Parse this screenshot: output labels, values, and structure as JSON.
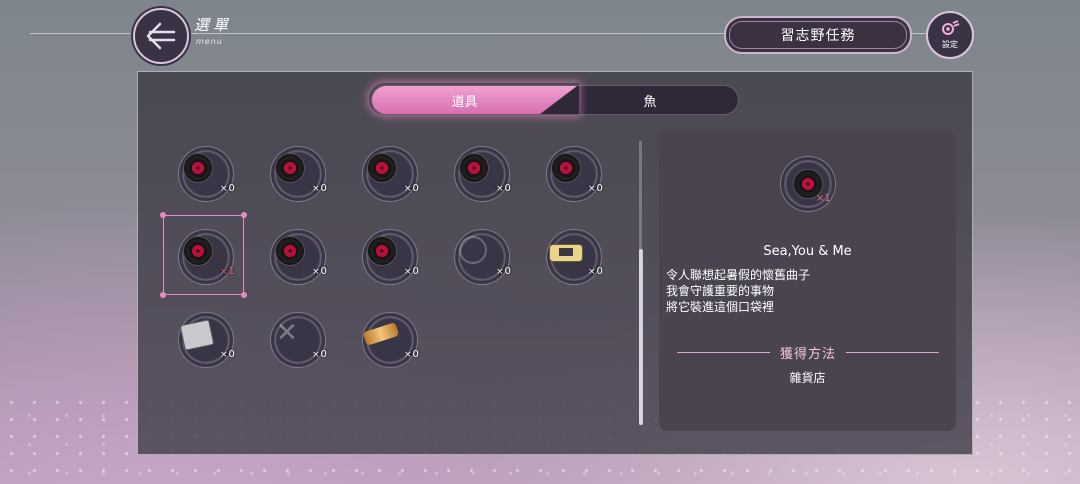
{
  "header": {
    "menu_title": "選單",
    "menu_subtitle": "menu",
    "mission_button": "習志野任務",
    "settings_label": "設定"
  },
  "tabs": [
    {
      "label": "道具",
      "active": true
    },
    {
      "label": "魚",
      "active": false
    }
  ],
  "items": [
    {
      "icon": "vinyl-record-icon",
      "count": "0"
    },
    {
      "icon": "vinyl-record-icon",
      "count": "0"
    },
    {
      "icon": "vinyl-record-icon",
      "count": "0"
    },
    {
      "icon": "vinyl-record-icon",
      "count": "0"
    },
    {
      "icon": "vinyl-record-icon",
      "count": "0"
    },
    {
      "icon": "vinyl-record-icon",
      "count": "1",
      "selected": true
    },
    {
      "icon": "vinyl-record-icon",
      "count": "0"
    },
    {
      "icon": "vinyl-record-icon",
      "count": "0"
    },
    {
      "icon": "locked-vinyl-icon",
      "count": "0"
    },
    {
      "icon": "game-console-icon",
      "count": "0"
    },
    {
      "icon": "dresser-icon",
      "count": "0"
    },
    {
      "icon": "locked-item-icon",
      "count": "0"
    },
    {
      "icon": "golden-scroll-icon",
      "count": "0"
    }
  ],
  "detail": {
    "icon": "vinyl-record-icon",
    "count": "1",
    "name": "Sea,You & Me",
    "description": [
      "令人聯想起暑假的懷舊曲子",
      "我會守護重要的事物",
      "將它裝進這個口袋裡"
    ],
    "obtain_heading": "獲得方法",
    "obtain_source": "雜貨店"
  },
  "colors": {
    "accent": "#e48cc6",
    "count_highlight": "#e06a7a"
  }
}
